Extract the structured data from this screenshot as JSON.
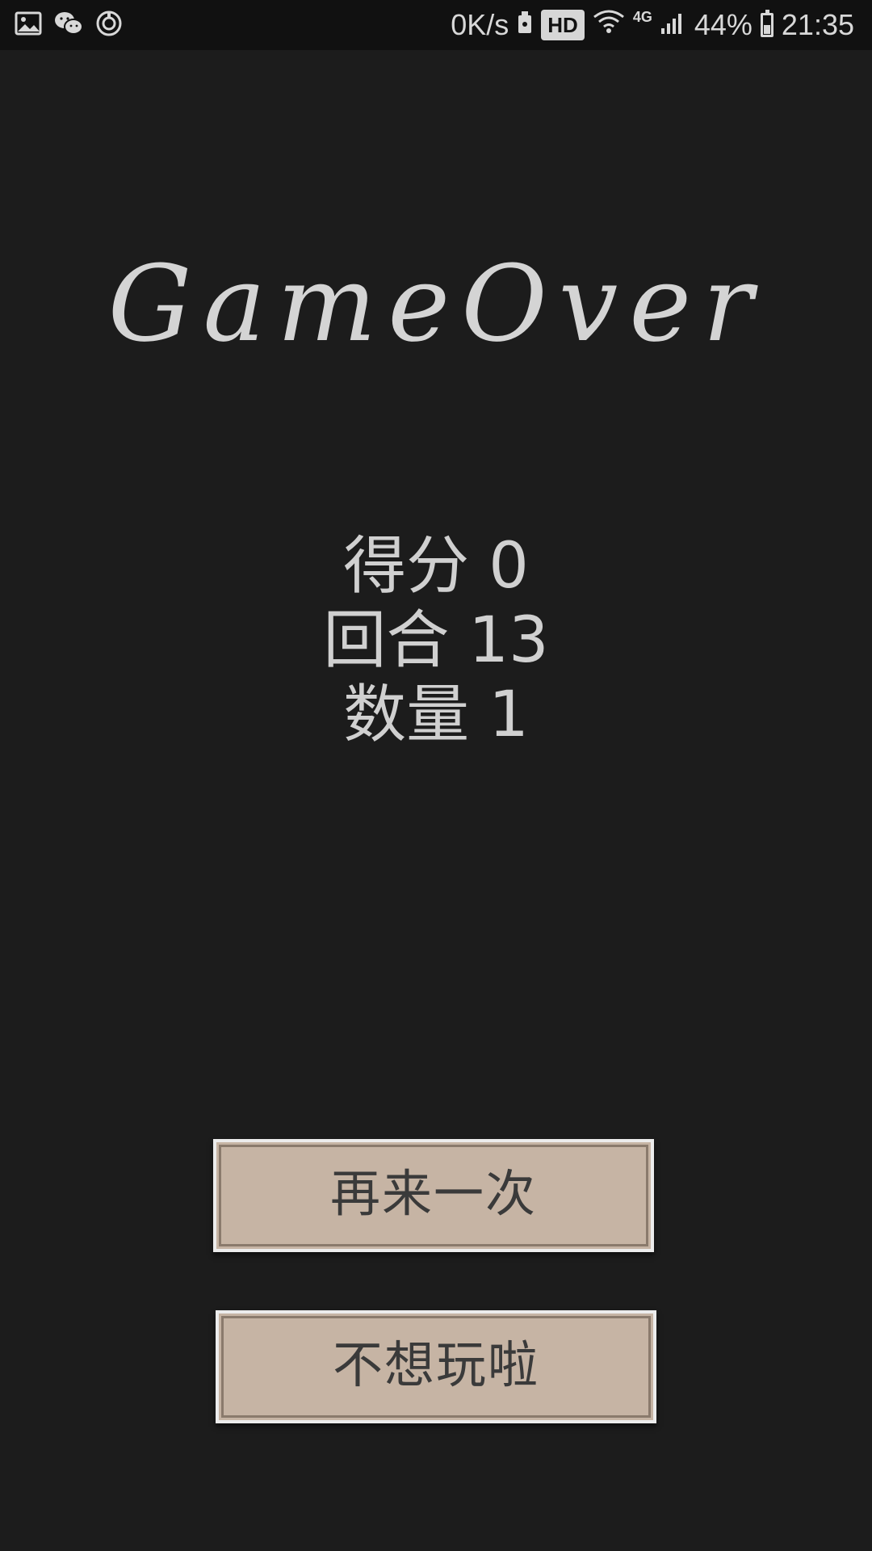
{
  "status_bar": {
    "left_icons": [
      "gallery-icon",
      "wechat-icon",
      "sync-icon"
    ],
    "net_speed": "0K/s",
    "hd_label": "HD",
    "network_type": "4G",
    "battery_percent_text": "44%",
    "battery_level": 0.44,
    "time": "21:35"
  },
  "game": {
    "title": "GameOver",
    "stats": [
      {
        "label": "得分",
        "value": "0"
      },
      {
        "label": "回合",
        "value": "13"
      },
      {
        "label": "数量",
        "value": "1"
      }
    ]
  },
  "buttons": {
    "retry_label": "再来一次",
    "quit_label": "不想玩啦"
  },
  "colors": {
    "background": "#1c1c1c",
    "status_bar": "#111111",
    "button_fill": "#c6b4a4",
    "text_light": "#d0d0d0"
  }
}
